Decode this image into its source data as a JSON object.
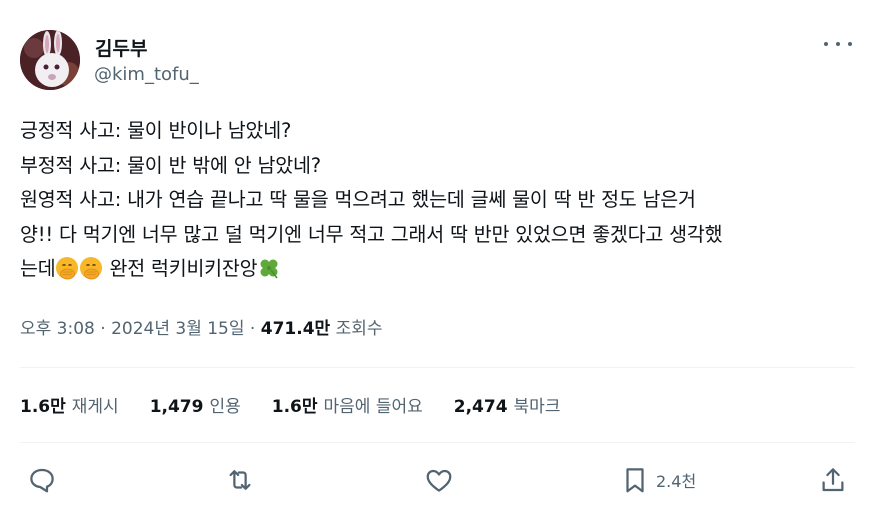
{
  "author": {
    "name": "김두부",
    "handle": "@kim_tofu_"
  },
  "tweet": {
    "lines": [
      "긍정적 사고: 물이 반이나 남았네?",
      "부정적 사고: 물이 반 밖에 안 남았네?",
      "원영적 사고: 내가 연습 끝나고 딱 물을 먹으려고 했는데 글쎄 물이 딱 반 정도 남은거",
      "양!! 다 먹기엔 너무 많고 덜 먹기엔 너무 적고 그래서 딱 반만 있었으면 좋겠다고 생각했"
    ],
    "last_line_start": "는데",
    "last_line_end": " 완전 럭키비키잔앙",
    "emoji": [
      "face-with-hand-over-mouth",
      "face-with-hand-over-mouth",
      "four-leaf-clover"
    ]
  },
  "meta": {
    "time": "오후 3:08",
    "sep1": " · ",
    "date": "2024년 3월 15일",
    "sep2": " · ",
    "views_count": "471.4만",
    "views_label": " 조회수"
  },
  "stats": [
    {
      "count": "1.6만",
      "label": "재게시"
    },
    {
      "count": "1,479",
      "label": "인용"
    },
    {
      "count": "1.6만",
      "label": "마음에 들어요"
    },
    {
      "count": "2,474",
      "label": "북마크"
    }
  ],
  "actions": {
    "bookmark_count": "2.4천"
  },
  "colors": {
    "text": "#0f1419",
    "secondary": "#536471",
    "divider": "#eff3f4"
  }
}
